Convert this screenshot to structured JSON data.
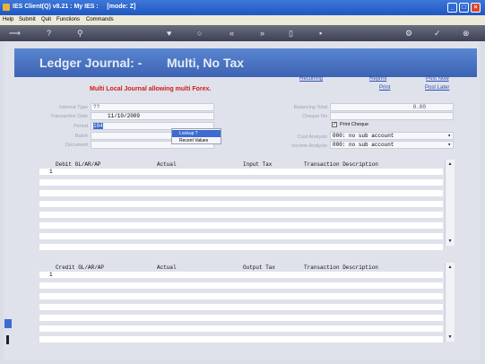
{
  "window": {
    "title": "IES Client(Q) v8.21 : My IES :     [mode: Z]"
  },
  "menu": [
    "Help",
    "Submit",
    "Quit",
    "Functions",
    "Commands"
  ],
  "page": {
    "title": "Ledger Journal: -",
    "subtitle": "Multi, No Tax"
  },
  "links": {
    "recurring": "Recurring",
    "reprint": "Reprint",
    "print": "Print",
    "post_now": "Post Now",
    "post_later": "Post Later"
  },
  "warning": "Multi Local Journal allowing multi Forex.",
  "form": {
    "internal_type_label": "Internal Type",
    "internal_type_value": "??",
    "transaction_date_label": "Transaction Date",
    "transaction_date_value": "11/10/2009",
    "period_label": "Period",
    "period_value": "104",
    "batch_label": "Batch",
    "document_label": "Document",
    "balancing_total_label": "Balancing Total",
    "balancing_total_value": "0.00",
    "cheque_no_label": "Cheque No",
    "print_cheque_label": "Print Cheque",
    "print_cheque_checked": true,
    "cost_analysis_label": "Cost Analysis",
    "cost_analysis_value": "000: no sub account",
    "income_analysis_label": "Income Analysis",
    "income_analysis_value": "000: no sub account"
  },
  "context_menu": {
    "items": [
      "Lookup ?",
      "Recent Values"
    ],
    "selected": 0
  },
  "debit_grid": {
    "columns": [
      "Debit GL/AR/AP",
      "Actual",
      "Input Tax",
      "Transaction Description"
    ],
    "row_number": "1"
  },
  "credit_grid": {
    "columns": [
      "Credit GL/AR/AP",
      "Actual",
      "Output Tax",
      "Transaction Description"
    ],
    "row_number": "1"
  }
}
